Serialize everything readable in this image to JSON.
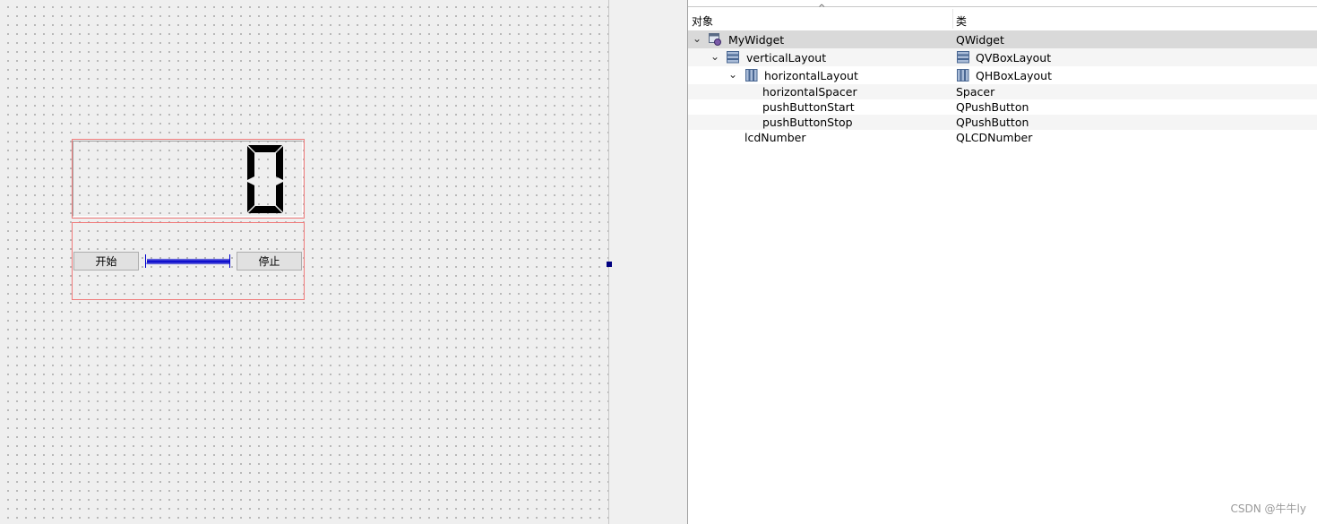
{
  "canvas": {
    "lcd_value": "0",
    "start_button_label": "开始",
    "stop_button_label": "停止"
  },
  "inspector": {
    "columns": {
      "object": "对象",
      "class": "类"
    },
    "rows": [
      {
        "name": "MyWidget",
        "class": "QWidget",
        "icon": "widget-icon",
        "expanded": true
      },
      {
        "name": "verticalLayout",
        "class": "QVBoxLayout",
        "icon": "vbox-layout-icon",
        "expanded": true
      },
      {
        "name": "horizontalLayout",
        "class": "QHBoxLayout",
        "icon": "hbox-layout-icon",
        "expanded": true
      },
      {
        "name": "horizontalSpacer",
        "class": "Spacer"
      },
      {
        "name": "pushButtonStart",
        "class": "QPushButton"
      },
      {
        "name": "pushButtonStop",
        "class": "QPushButton"
      },
      {
        "name": "lcdNumber",
        "class": "QLCDNumber"
      }
    ]
  },
  "watermark": "CSDN @牛牛ly",
  "colors": {
    "layout_border": "#f07b7b",
    "selection": "#d9d9d9",
    "spacer": "#0000cc",
    "handle": "#000080"
  }
}
